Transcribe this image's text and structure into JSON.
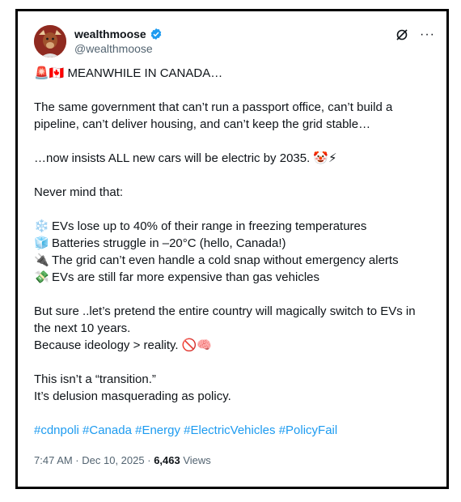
{
  "post": {
    "display_name": "wealthmoose",
    "handle": "@wealthmoose",
    "verified": true,
    "headline_emoji": "🚨🇨🇦",
    "headline": "MEANWHILE IN CANADA…",
    "para1": "The same government that can’t run a passport office, can’t build a pipeline, can’t deliver housing, and can’t keep the grid stable…",
    "para2": "…now insists ALL new cars will be electric by 2035.",
    "para2_emoji": "🤡⚡",
    "para3": "Never mind that:",
    "bullets": [
      {
        "icon": "❄️",
        "text": "EVs lose up to 40% of their range in freezing temperatures"
      },
      {
        "icon": "🧊",
        "text": "Batteries struggle in –20°C (hello, Canada!)"
      },
      {
        "icon": "🔌",
        "text": "The grid can’t even handle a cold snap without emergency alerts"
      },
      {
        "icon": "💸",
        "text": "EVs are still far more expensive than gas vehicles"
      }
    ],
    "para4_line1": "But sure ..let’s pretend the entire country will magically switch to EVs in the next 10 years.",
    "para4_line2": "Because ideology > reality.",
    "para4_emoji": "🚫🧠",
    "para5_line1": "This isn’t a “transition.”",
    "para5_line2": "It’s delusion masquerading as policy.",
    "hashtags": "#cdnpoli #Canada #Energy #ElectricVehicles #PolicyFail",
    "timestamp": "7:47 AM · Dec 10, 2025",
    "separator": "·",
    "views_count": "6,463",
    "views_label": "Views"
  },
  "colors": {
    "accent": "#1d9bf0",
    "text": "#0f1419",
    "muted": "#536471"
  },
  "icons": {
    "verified": "verified-badge-icon",
    "grok": "grok-icon",
    "more": "more-icon"
  }
}
